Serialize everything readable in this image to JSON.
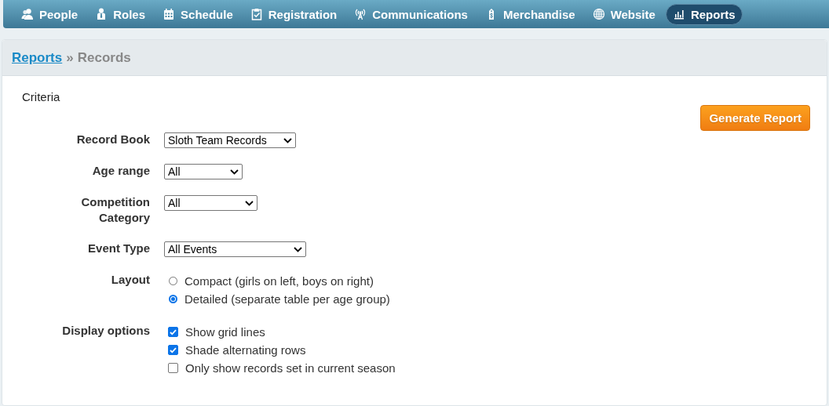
{
  "nav": [
    {
      "label": "People",
      "selected": false
    },
    {
      "label": "Roles",
      "selected": false
    },
    {
      "label": "Schedule",
      "selected": false
    },
    {
      "label": "Registration",
      "selected": false
    },
    {
      "label": "Communications",
      "selected": false
    },
    {
      "label": "Merchandise",
      "selected": false
    },
    {
      "label": "Website",
      "selected": false
    },
    {
      "label": "Reports",
      "selected": true
    }
  ],
  "breadcrumb": {
    "link": "Reports",
    "separator": "»",
    "current": "Records"
  },
  "section_title": "Criteria",
  "generate_button": "Generate Report",
  "fields": [
    {
      "kind": "select",
      "label": "Record Book",
      "value": "Sloth Team Records"
    },
    {
      "kind": "select",
      "label": "Age range",
      "value": "All"
    },
    {
      "kind": "select",
      "label": "Competition Category",
      "value": "All"
    },
    {
      "kind": "select",
      "label": "Event Type",
      "value": "All Events"
    },
    {
      "kind": "radio",
      "label": "Layout",
      "options": [
        {
          "label": "Compact (girls on left, boys on right)",
          "selected": false
        },
        {
          "label": "Detailed (separate table per age group)",
          "selected": true
        }
      ]
    },
    {
      "kind": "checkbox",
      "label": "Display options",
      "options": [
        {
          "label": "Show grid lines",
          "checked": true
        },
        {
          "label": "Shade alternating rows",
          "checked": true
        },
        {
          "label": "Only show records set in current season",
          "checked": false
        }
      ]
    }
  ]
}
